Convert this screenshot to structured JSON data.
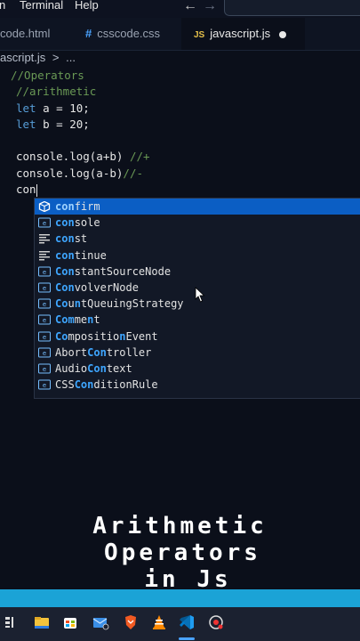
{
  "menubar": {
    "items": [
      "n",
      "Terminal",
      "Help"
    ]
  },
  "tabs": [
    {
      "label": "code.html",
      "icon": "html-file-icon"
    },
    {
      "label": "csscode.css",
      "icon": "css-file-icon",
      "prefix": "#"
    },
    {
      "label": "javascript.js",
      "icon": "js-file-icon",
      "prefix": "JS",
      "active": true,
      "unsaved": true
    }
  ],
  "breadcrumb": {
    "file": "ascript.js",
    "separator": ">",
    "more": "..."
  },
  "code": {
    "l1": "//Operators",
    "l2": "//arithmetic",
    "l3_kw": "let",
    "l3_rest": " a = 10;",
    "l4_kw": "let",
    "l4_rest": " b = 20;",
    "l6_code": "console.log(a+b) ",
    "l6_cmt": "//+",
    "l7_code": "console.log(a-b)",
    "l7_cmt": "//-",
    "l8": "con"
  },
  "suggestions": [
    {
      "pre": "",
      "hl": "con",
      "post": "firm",
      "icon": "cube-icon",
      "selected": true
    },
    {
      "pre": "",
      "hl": "con",
      "post": "sole",
      "icon": "variable-icon"
    },
    {
      "pre": "",
      "hl": "con",
      "post": "st",
      "icon": "keyword-icon"
    },
    {
      "pre": "",
      "hl": "con",
      "post": "tinue",
      "icon": "keyword-icon"
    },
    {
      "pre": "",
      "hl": "Con",
      "post": "stantSourceNode",
      "icon": "variable-icon"
    },
    {
      "pre": "",
      "hl": "Con",
      "post": "volverNode",
      "icon": "variable-icon"
    },
    {
      "pre": "",
      "hl": "Co",
      "post": "u",
      "hl2": "n",
      "post2": "tQueuingStrategy",
      "icon": "variable-icon"
    },
    {
      "pre": "",
      "hl": "Com",
      "post": "me",
      "hl2": "n",
      "post2": "t",
      "icon": "variable-icon"
    },
    {
      "pre": "",
      "hl": "Co",
      "post": "mpositio",
      "hl2": "n",
      "post2": "Event",
      "icon": "variable-icon"
    },
    {
      "pre": "Abort",
      "hl": "Con",
      "post": "troller",
      "icon": "variable-icon"
    },
    {
      "pre": "Audio",
      "hl": "Con",
      "post": "text",
      "icon": "variable-icon"
    },
    {
      "pre": "CSS",
      "hl": "Con",
      "post": "ditionRule",
      "icon": "variable-icon"
    }
  ],
  "caption": {
    "line1": "Arithmetic",
    "line2": "Operators",
    "line3": "in Js"
  },
  "colors": {
    "status_bar": "#1ba3d6",
    "selection": "#0b5ec4",
    "match": "#3ea6ff"
  }
}
